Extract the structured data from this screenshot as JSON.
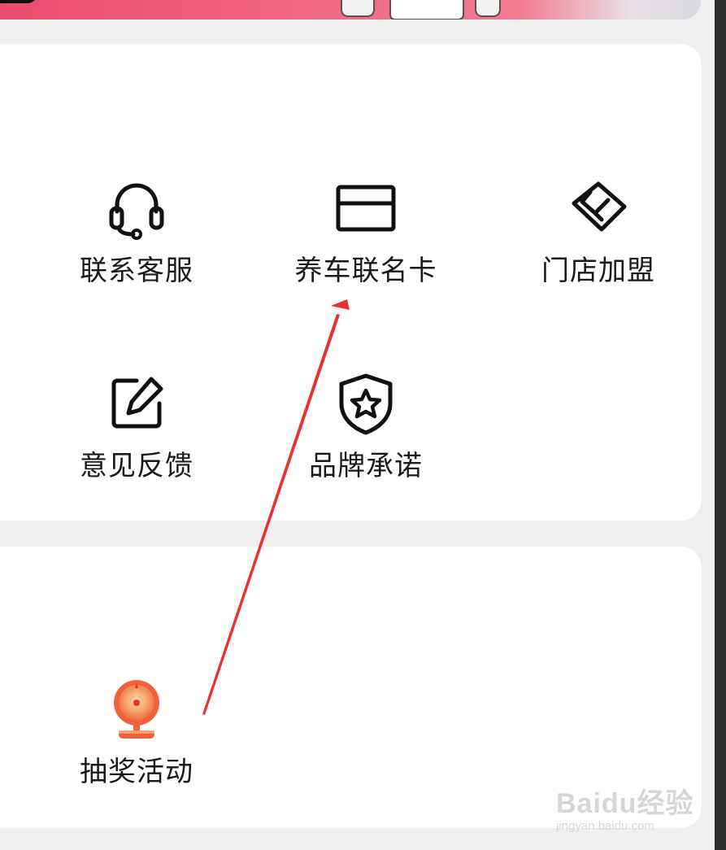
{
  "services": {
    "items": [
      {
        "label": "联系客服",
        "icon": "headset-icon"
      },
      {
        "label": "养车联名卡",
        "icon": "card-icon"
      },
      {
        "label": "门店加盟",
        "icon": "handshake-icon"
      },
      {
        "label": "意见反馈",
        "icon": "edit-icon"
      },
      {
        "label": "品牌承诺",
        "icon": "shield-star-icon"
      }
    ]
  },
  "activities": {
    "items": [
      {
        "label": "抽奖活动",
        "icon": "lottery-wheel-icon"
      }
    ]
  },
  "annotation": {
    "arrow_color": "#e8322d"
  },
  "watermark": {
    "main": "Baidu经验",
    "sub": "jingyan.baidu.com"
  }
}
